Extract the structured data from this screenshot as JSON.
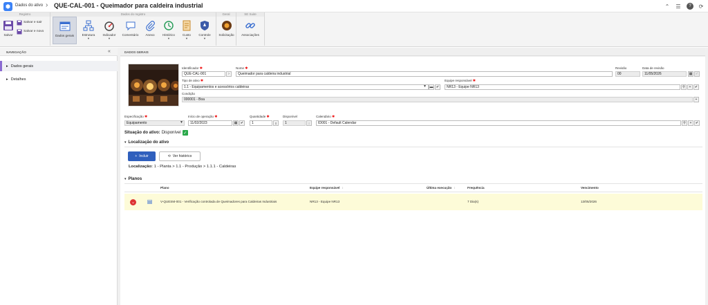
{
  "titlebar": {
    "breadcrumb": "Dados do ativo",
    "title": "QUE-CAL-001 - Queimador para caldeira industrial"
  },
  "ribbon": {
    "groups": {
      "registro": "Registro",
      "dados_registro": "Dados do registro",
      "geral": "Geral",
      "se_suite": "SE Suite"
    },
    "buttons": {
      "salvar": "Salvar",
      "salvar_sair": "Salvar e sair",
      "salvar_novo": "Salvar e novo",
      "dados_gerais": "Dados gerais",
      "estrutura": "Estrutura",
      "indicador": "Indicador",
      "comentario": "Comentário",
      "anexo": "Anexo",
      "historico": "Histórico",
      "custo": "Custo",
      "controle": "Controle",
      "solicitacao": "Solicitação",
      "associacoes": "Associações"
    }
  },
  "sidebar": {
    "title": "NAVEGAÇÃO",
    "items": [
      {
        "label": "Dados gerais"
      },
      {
        "label": "Detalhes"
      }
    ]
  },
  "main": {
    "section_title": "DADOS GERAIS",
    "form": {
      "identificador_label": "Identificador",
      "identificador": "QUE-CAL-001",
      "nome_label": "Nome",
      "nome": "Queimador para caldeira industrial",
      "revisao_label": "Revisão",
      "revisao": "00",
      "data_revisao_label": "Data de revisão",
      "data_revisao": "11/05/2026",
      "tipo_label": "Tipo de ativo",
      "tipo": "1.1 - Equipamentos e acessórios caldeiras",
      "equipe_label": "Equipe responsável",
      "equipe": "NR13 - Equipe NR13",
      "condicao_label": "Condição",
      "condicao": "000001 - Boa",
      "especificacao_label": "Especificação",
      "especificacao": "Equipamento",
      "inicio_label": "Início de operação",
      "inicio": "11/02/2023",
      "quantidade_label": "Quantidade",
      "quantidade": "1",
      "disponivel_label": "Disponível",
      "disponivel": "1",
      "calendario_label": "Calendário",
      "calendario": "ID001 - Default Calendar",
      "situacao_label": "Situação do ativo:",
      "situacao": "Disponível"
    },
    "localizacao": {
      "title": "Localização do ativo",
      "incluir": "Incluir",
      "ver_historico": "Ver histórico",
      "label": "Localização:",
      "path": "1 - Planta > 1.1 - Produção > 1.1.1 - Caldeiras"
    },
    "planos": {
      "title": "Planos",
      "columns": {
        "plano": "Plano",
        "equipe": "Equipe responsável",
        "ultima": "Última execução",
        "frequencia": "Frequência",
        "vencimento": "Vencimento"
      },
      "rows": [
        {
          "plano": "V-QUESM-001 - Verificação controlada de Queimadores para Caldeiras Industriais",
          "equipe": "NR13 - Equipe NR13",
          "ultima": "",
          "frequencia": "7 Dia(s)",
          "vencimento": "13/05/2026"
        }
      ]
    }
  },
  "colors": {
    "accent": "#2f5fbd",
    "nav_selected": "#8a6ad1",
    "row_highlight": "#fdfbd8",
    "required": "#e11111"
  }
}
